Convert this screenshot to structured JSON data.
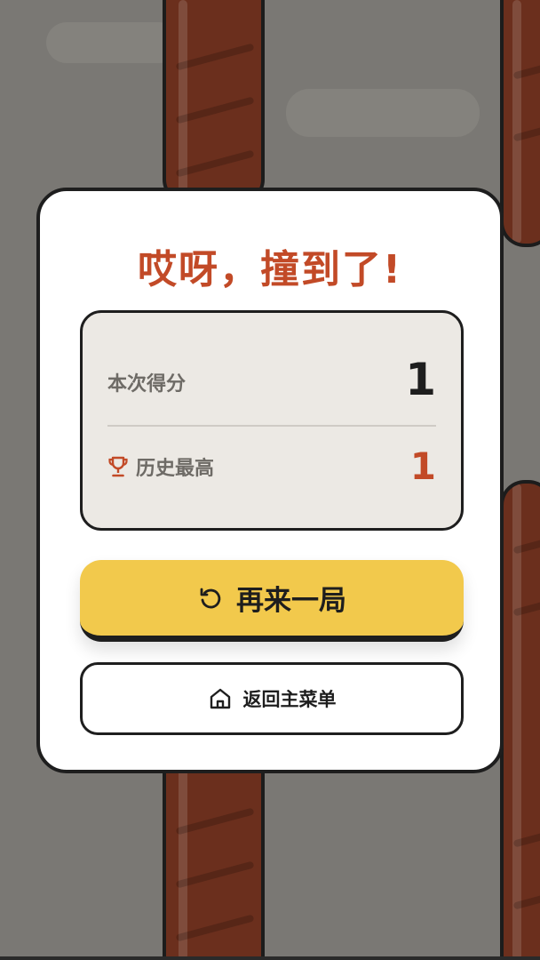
{
  "colors": {
    "background": "#7a7874",
    "pipe": "#6b2f1d",
    "accent": "#c24a27",
    "retry_button": "#f2c94c",
    "panel": "#ece9e4"
  },
  "dialog": {
    "title": "哎呀，撞到了!",
    "current_score_label": "本次得分",
    "current_score": "1",
    "best_score_label": "历史最高",
    "best_score": "1",
    "best_icon": "trophy-icon"
  },
  "buttons": {
    "retry_label": "再来一局",
    "retry_icon": "restart-icon",
    "home_label": "返回主菜单",
    "home_icon": "home-icon"
  }
}
